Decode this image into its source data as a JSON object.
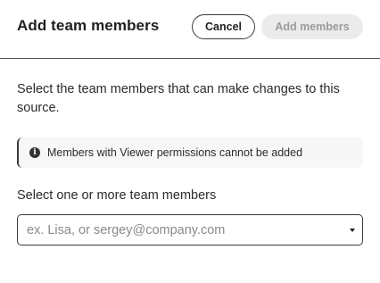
{
  "dialog": {
    "title": "Add team members",
    "cancel_label": "Cancel",
    "add_label": "Add members"
  },
  "body": {
    "description": "Select the team members that can make changes to this source.",
    "notice": {
      "icon": "info-icon",
      "icon_glyph": "i",
      "text": "Members with Viewer permissions cannot be added"
    },
    "member_field": {
      "label": "Select one or more team members",
      "placeholder": "ex. Lisa, or sergey@company.com",
      "value": ""
    }
  },
  "colors": {
    "primary_text": "#1f1f1f",
    "disabled_button_bg": "#ebebeb",
    "disabled_button_text": "#9a9a9a",
    "notice_bg": "#f7f7f7",
    "border": "#3a3a3a"
  }
}
